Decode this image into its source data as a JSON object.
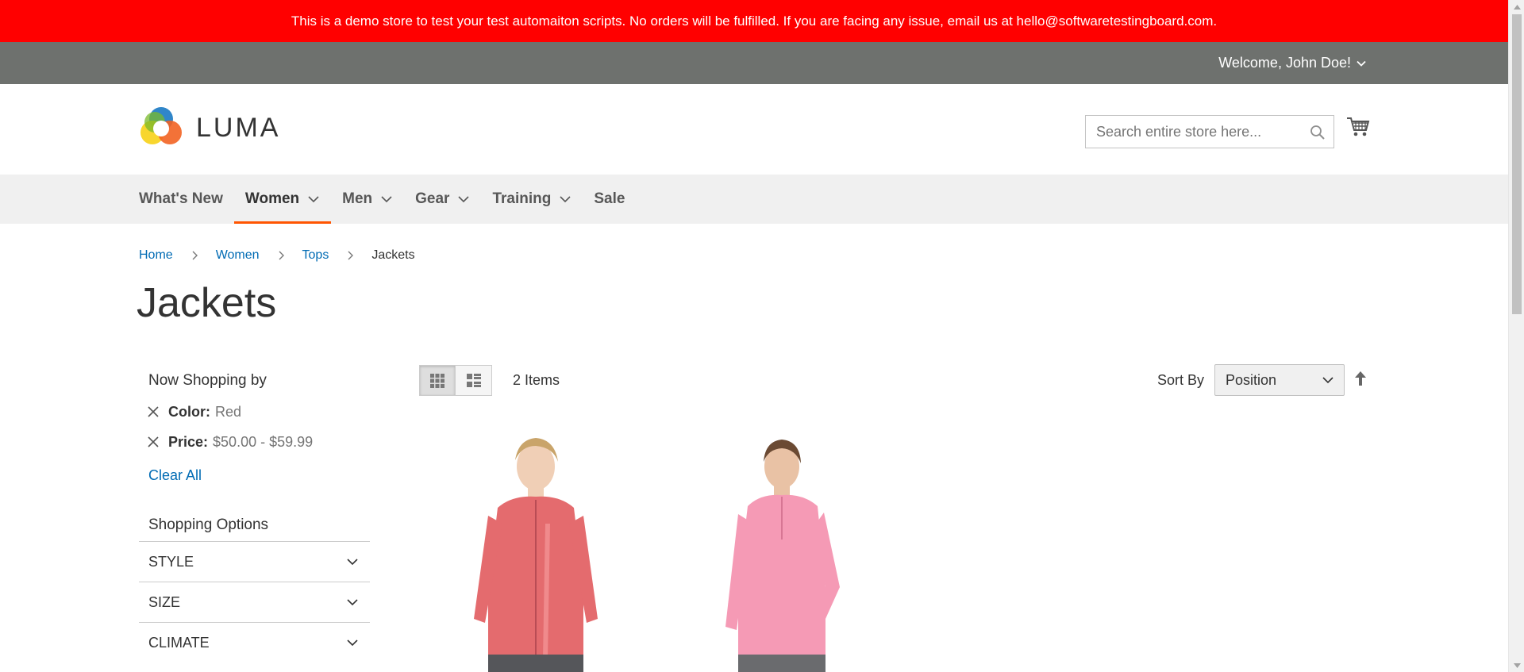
{
  "banner": {
    "text": "This is a demo store to test your test automaiton scripts. No orders will be fulfilled. If you are facing any issue, email us at hello@softwaretestingboard.com."
  },
  "header": {
    "welcome": "Welcome, John Doe!",
    "logo_text": "LUMA",
    "search_placeholder": "Search entire store here..."
  },
  "nav": {
    "items": [
      {
        "label": "What's New",
        "dropdown": false
      },
      {
        "label": "Women",
        "dropdown": true,
        "active": true
      },
      {
        "label": "Men",
        "dropdown": true
      },
      {
        "label": "Gear",
        "dropdown": true
      },
      {
        "label": "Training",
        "dropdown": true
      },
      {
        "label": "Sale",
        "dropdown": false
      }
    ]
  },
  "breadcrumb": [
    "Home",
    "Women",
    "Tops",
    "Jackets"
  ],
  "page_title": "Jackets",
  "sidebar": {
    "now_shopping_title": "Now Shopping by",
    "filters": [
      {
        "label": "Color:",
        "value": "Red"
      },
      {
        "label": "Price:",
        "value": "$50.00 - $59.99"
      }
    ],
    "clear_all": "Clear All",
    "options_title": "Shopping Options",
    "option_groups": [
      "STYLE",
      "SIZE",
      "CLIMATE"
    ]
  },
  "toolbar": {
    "item_count": "2 Items",
    "sort_label": "Sort By",
    "sort_value": "Position"
  },
  "colors": {
    "banner": "#ff0000",
    "panel": "#6e716e",
    "link": "#006bb4",
    "nav_active_underline": "#ff5501",
    "product1_jacket": "#e46b6e",
    "product2_jacket": "#f59ab5"
  }
}
